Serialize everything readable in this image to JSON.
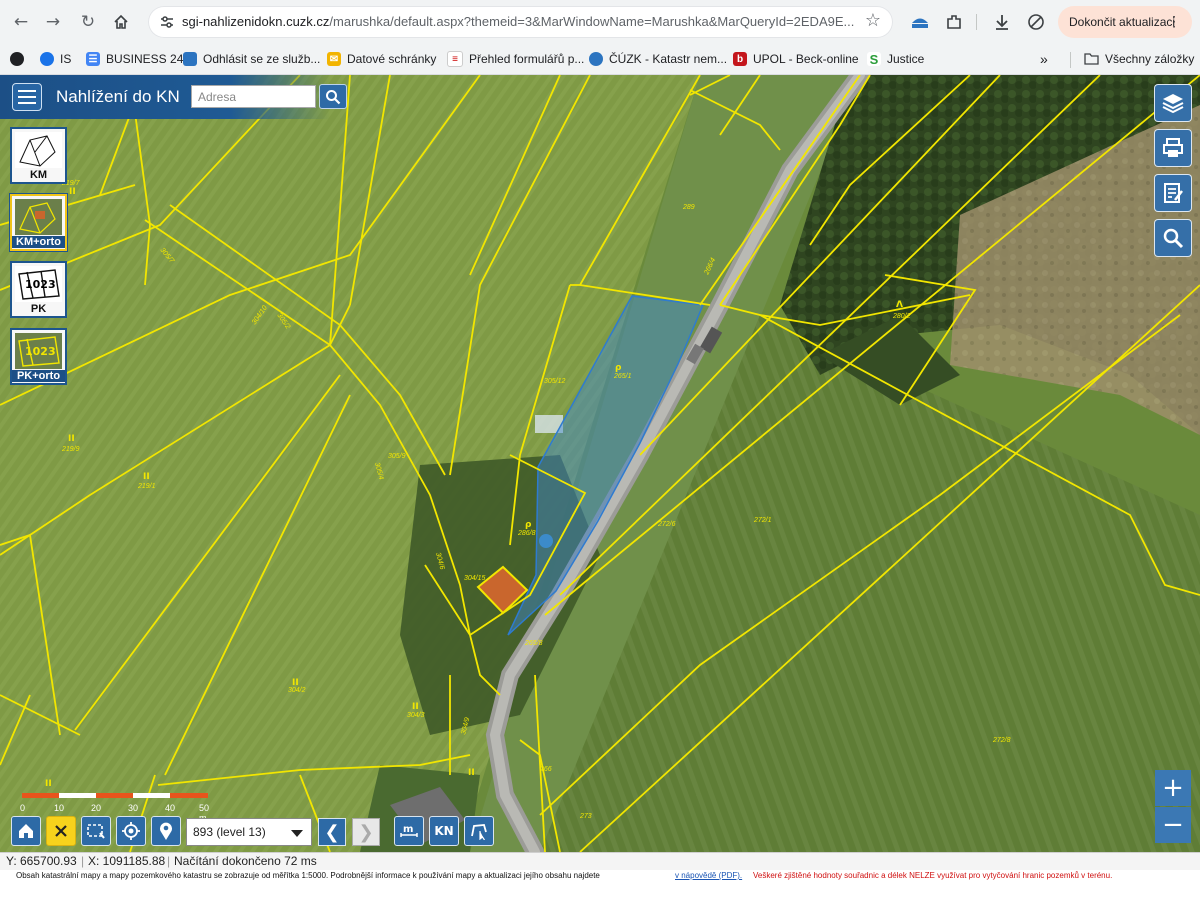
{
  "browser": {
    "url_host": "sgi-nahlizenidokn.cuzk.cz",
    "url_rest": "/marushka/default.aspx?themeid=3&MarWindowName=Marushka&MarQueryId=2EDA9E...",
    "update_label": "Dokončit aktualizaci",
    "bookmarks": [
      "IS",
      "BUSINESS 24",
      "Odhlásit se ze služb...",
      "Datové schránky",
      "Přehled formulářů p...",
      "ČÚZK - Katastr nem...",
      "UPOL - Beck-online",
      "Justice"
    ],
    "all_bookmarks_label": "Všechny záložky",
    "overflow_label": "»"
  },
  "app": {
    "title": "Nahlížení do KN",
    "search_placeholder": "Adresa"
  },
  "layers": [
    "KM",
    "KM+orto",
    "PK",
    "PK+orto"
  ],
  "scale": {
    "labels": [
      "0",
      "10",
      "20",
      "30",
      "40",
      "50 m"
    ]
  },
  "level_select": "893 (level 13)",
  "map_labels": {
    "p2197": "219/7",
    "p2199": "219/9",
    "p2191": "219/1",
    "p30410": "304/10",
    "p30512": "305/12",
    "p3059": "305/9",
    "p3054": "305/4",
    "p3042": "304/2",
    "p3043": "304/3",
    "p30415": "304/15",
    "p289": "289",
    "p2651": "265/1",
    "p2652": "265/2",
    "p2664": "266/4",
    "p2658": "265/8",
    "p2802": "280/2",
    "p2726": "272/6",
    "p2721": "272/1",
    "p2728": "272/8",
    "p266": "266",
    "p273": "273",
    "p3049": "304/9",
    "p3052": "305/2",
    "p3046": "304/6",
    "p2868": "286/8",
    "p3057": "305/7"
  },
  "status": {
    "y_coord": "Y: 665700.93",
    "x_coord": "X: 1091185.88",
    "load_msg": "Načítání dokončeno 72 ms"
  },
  "footnote": {
    "text": "Obsah katastrální mapy a mapy pozemkového katastru se zobrazuje od měřítka 1:5000. Podrobnější informace k používání mapy a aktualizaci jejího obsahu najdete",
    "link": "v nápovědě (PDF).",
    "warning": "Veškeré zjištěné hodnoty souřadnic a délek NELZE využívat pro vytyčování hranic pozemků v terénu."
  },
  "colors": {
    "parcel_line": "#f2e600",
    "highlight": "#3b87d6",
    "app_blue": "#1c4f86"
  }
}
